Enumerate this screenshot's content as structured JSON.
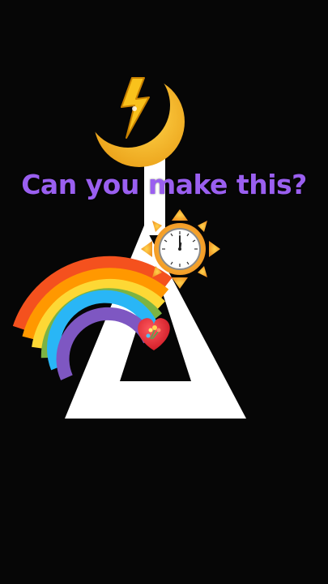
{
  "prompt": {
    "text": "Can you make this?",
    "color": "#9a5ff0"
  },
  "colors": {
    "background": "#060606",
    "shape": "#ffffff",
    "moon": "#f5b41a",
    "bolt": "#f9c21c",
    "sun": "#f4a82a",
    "clock_face": "#ffffff",
    "heart": "#e8232e",
    "rainbow": [
      "#f4511e",
      "#ff9800",
      "#fdd835",
      "#7cb342",
      "#29b6f6",
      "#7e57c2"
    ]
  },
  "pieces": [
    {
      "name": "moon-icon",
      "shape": "crescent moon"
    },
    {
      "name": "lightning-icon",
      "shape": "lightning bolt"
    },
    {
      "name": "sun-clock-icon",
      "shape": "sun with clock"
    },
    {
      "name": "rainbow-icon",
      "shape": "rainbow"
    },
    {
      "name": "heart-icon",
      "shape": "heart with bouquet"
    },
    {
      "name": "triangle-shape",
      "shape": "hollow white triangle"
    }
  ]
}
